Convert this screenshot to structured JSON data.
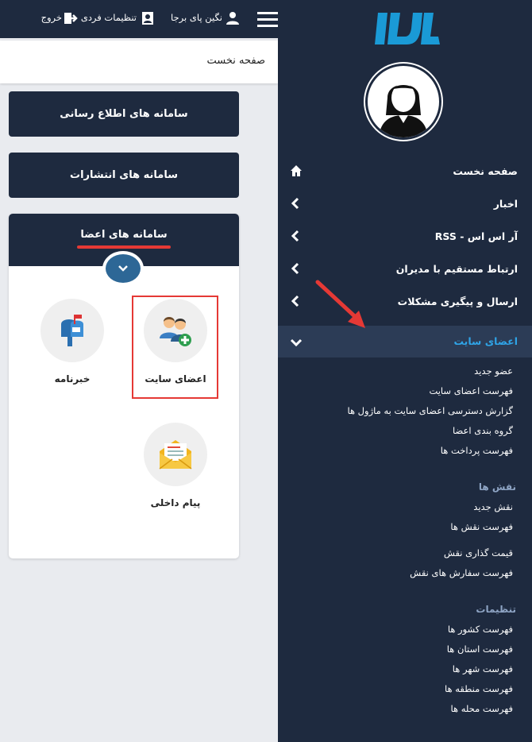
{
  "topbar": {
    "user_name": "نگین پای برجا",
    "settings_label": "تنظیمات فردی",
    "logout_label": "خروج"
  },
  "page_title": "صفحه نخست",
  "panels": {
    "info_systems": "سامانه های اطلاع رسانی",
    "publications": "سامانه های انتشارات",
    "members_systems": "سامانه های اعضا"
  },
  "tiles": {
    "site_members": "اعضای سایت",
    "newsletter": "خبرنامه",
    "internal_message": "پیام داخلی"
  },
  "sidebar": {
    "nav": [
      "صفحه نخست",
      "اخبار",
      "آر اس اس - RSS",
      "ارتباط مستقیم با مدیران",
      "ارسال و پیگیری مشکلات",
      "اعضای سایت"
    ],
    "members_sub": [
      "عضو جدید",
      "فهرست اعضای سایت",
      "گزارش دسترسی اعضای سایت به ماژول ها",
      "گروه بندی اعضا",
      "فهرست پرداخت ها"
    ],
    "roles_head": "نقش ها",
    "roles_sub": [
      "نقش جدید",
      "فهرست نقش ها"
    ],
    "role_price_sub": [
      "قیمت گذاری نقش",
      "فهرست سفارش های نقش"
    ],
    "settings_head": "تنظیمات",
    "settings_sub": [
      "فهرست کشور ها",
      "فهرست استان ها",
      "فهرست شهر ها",
      "فهرست منطقه ها",
      "فهرست محله ها"
    ]
  },
  "icons": [
    "home-icon",
    "chevron-left-icon",
    "chevron-down-icon",
    "user-icon",
    "settings-icon",
    "logout-icon",
    "hamburger-icon",
    "members-add-icon",
    "mailbox-icon",
    "envelope-icon"
  ],
  "colors": {
    "sidebar": "#1e2a3f",
    "accent": "#2fa4e7",
    "highlight": "#e53935",
    "logo": "#1a9ad6"
  }
}
